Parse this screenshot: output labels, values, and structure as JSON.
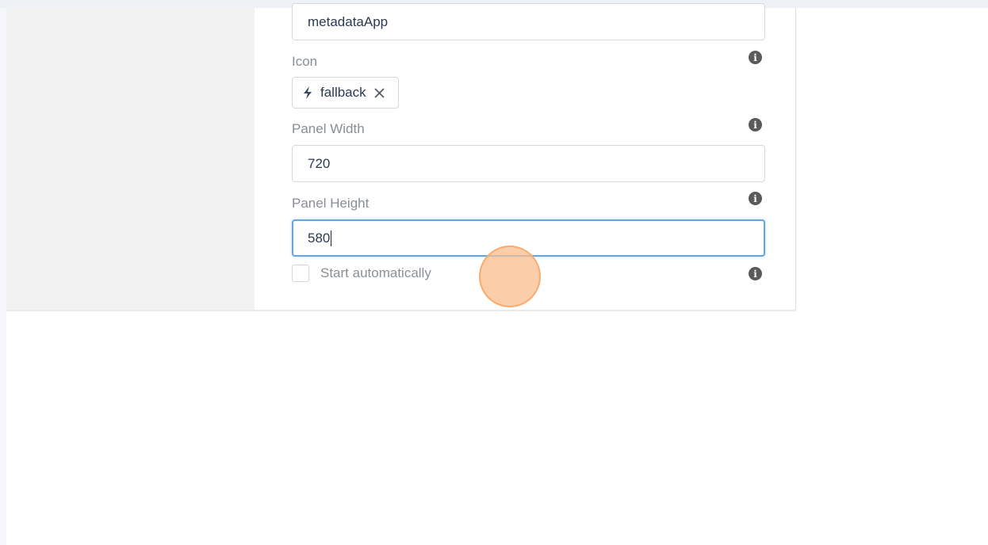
{
  "form": {
    "name_value": "metadataApp",
    "icon": {
      "label": "Icon",
      "chip_label": "fallback",
      "chip_icon": "bolt-icon",
      "remove_icon": "close-icon"
    },
    "panel_width": {
      "label": "Panel Width",
      "value": "720"
    },
    "panel_height": {
      "label": "Panel Height",
      "value": "580"
    },
    "start_automatically": {
      "label": "Start automatically",
      "checked": false
    },
    "info_icon": "info-icon"
  },
  "colors": {
    "focus_border": "#66a6dd",
    "click_indicator": "#fabe8c"
  }
}
